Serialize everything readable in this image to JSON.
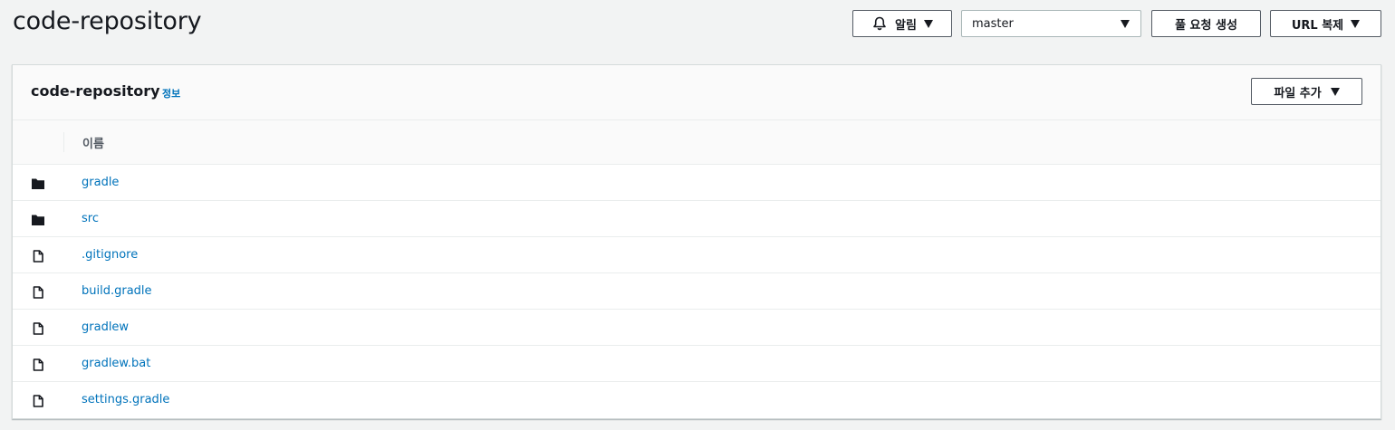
{
  "header": {
    "title": "code-repository",
    "notify_label": "알림",
    "branch": "master",
    "pull_request_label": "풀 요청 생성",
    "clone_url_label": "URL 복제"
  },
  "panel": {
    "title": "code-repository",
    "info_label": "정보",
    "add_file_label": "파일 추가",
    "column_name": "이름"
  },
  "files": [
    {
      "name": "gradle",
      "type": "folder"
    },
    {
      "name": "src",
      "type": "folder"
    },
    {
      "name": ".gitignore",
      "type": "file"
    },
    {
      "name": "build.gradle",
      "type": "file"
    },
    {
      "name": "gradlew",
      "type": "file"
    },
    {
      "name": "gradlew.bat",
      "type": "file"
    },
    {
      "name": "settings.gradle",
      "type": "file"
    }
  ],
  "colors": {
    "link": "#0073bb",
    "border_dark": "#545b64",
    "background": "#f2f3f3"
  }
}
